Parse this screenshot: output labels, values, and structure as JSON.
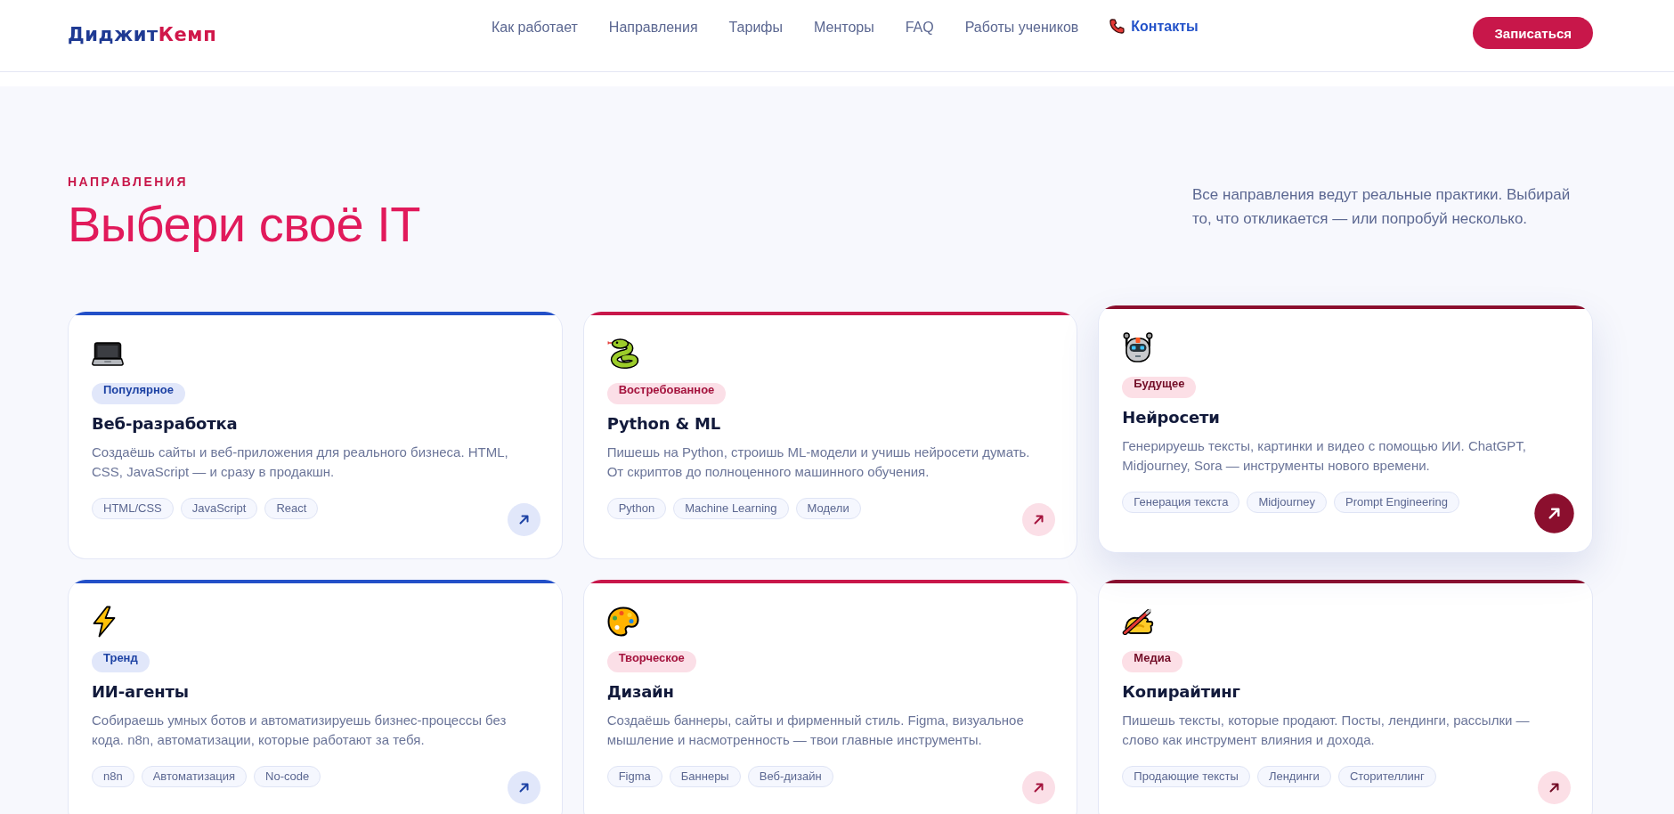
{
  "header": {
    "logo": {
      "primary": "Диджит",
      "accent": "Кемп"
    },
    "nav": [
      {
        "label": "Как работает",
        "kind": "link"
      },
      {
        "label": "Направления",
        "kind": "link"
      },
      {
        "label": "Тарифы",
        "kind": "link"
      },
      {
        "label": "Менторы",
        "kind": "link"
      },
      {
        "label": "FAQ",
        "kind": "link"
      },
      {
        "label": "Работы учеников",
        "kind": "link"
      },
      {
        "label": "Контакты",
        "kind": "contact"
      }
    ],
    "cta_button": "Записаться"
  },
  "section": {
    "eyebrow": "НАПРАВЛЕНИЯ",
    "heading": "Выбери своё IT",
    "intro": "Все направления ведут реальные практики. Выбирай то, что откликается — или попробуй несколько."
  },
  "cards": [
    {
      "color": "#2350c8",
      "hovered": false,
      "badge": "Популярное",
      "title": "Веб-разработка",
      "description": "Создаёшь сайты и веб-приложения для реального бизнеса. HTML, CSS, JavaScript — и сразу в продакшн.",
      "tags": [
        "HTML/CSS",
        "JavaScript",
        "React"
      ]
    },
    {
      "color": "#c8174a",
      "hovered": false,
      "badge": "Востребованное",
      "title": "Python & ML",
      "description": "Пишешь на Python, строишь ML-модели и учишь нейросети думать. От скриптов до полноценного машинного обучения.",
      "tags": [
        "Python",
        "Machine Learning",
        "Модели"
      ]
    },
    {
      "color": "#8b0f2e",
      "hovered": true,
      "badge": "Будущее",
      "title": "Нейросети",
      "description": "Генерируешь тексты, картинки и видео с помощью ИИ. ChatGPT, Midjourney, Sora — инструменты нового времени.",
      "tags": [
        "Генерация текста",
        "Midjourney",
        "Prompt Engineering"
      ]
    },
    {
      "color": "#2350c8",
      "hovered": false,
      "badge": "Тренд",
      "title": "ИИ-агенты",
      "description": "Собираешь умных ботов и автоматизируешь бизнес-процессы без кода. n8n, автоматизации, которые работают за тебя.",
      "tags": [
        "n8n",
        "Автоматизация",
        "No-code"
      ]
    },
    {
      "color": "#c8174a",
      "hovered": false,
      "badge": "Творческое",
      "title": "Дизайн",
      "description": "Создаёшь баннеры, сайты и фирменный стиль. Figma, визуальное мышление и насмотренность — твои главные инструменты.",
      "tags": [
        "Figma",
        "Баннеры",
        "Веб-дизайн"
      ]
    },
    {
      "color": "#8b0f2e",
      "hovered": false,
      "badge": "Медиа",
      "title": "Копирайтинг",
      "description": "Пишешь тексты, которые продают. Посты, лендинги, рассылки — слово как инструмент влияния и дохода.",
      "tags": [
        "Продающие тексты",
        "Лендинги",
        "Сторителлинг"
      ]
    }
  ]
}
